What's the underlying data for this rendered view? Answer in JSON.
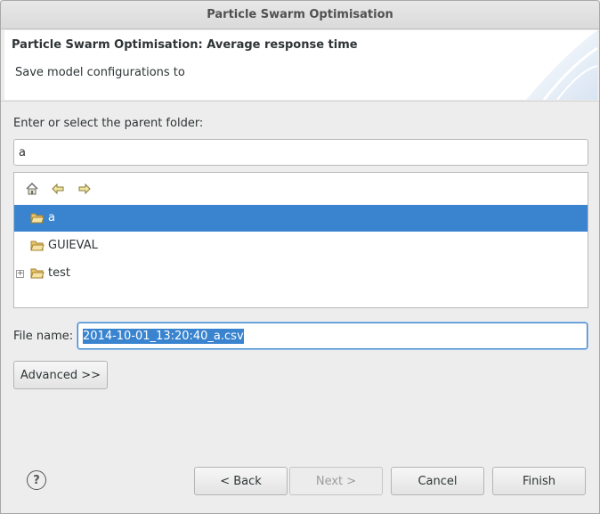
{
  "window": {
    "title": "Particle Swarm Optimisation"
  },
  "banner": {
    "title": "Particle Swarm Optimisation: Average response time",
    "description": "Save model configurations to"
  },
  "folder_section": {
    "label": "Enter or select the parent folder:",
    "value": "a"
  },
  "toolbar": {
    "icons": [
      "home-icon",
      "back-arrow-icon",
      "forward-arrow-icon"
    ]
  },
  "tree": {
    "items": [
      {
        "label": "a",
        "selected": true,
        "expandable": false
      },
      {
        "label": "GUIEVAL",
        "selected": false,
        "expandable": false
      },
      {
        "label": "test",
        "selected": false,
        "expandable": true
      }
    ]
  },
  "file": {
    "label": "File name:",
    "value": "2014-10-01_13:20:40_a.csv"
  },
  "buttons": {
    "advanced": "Advanced >>",
    "back": "< Back",
    "next": "Next >",
    "cancel": "Cancel",
    "finish": "Finish"
  },
  "help": {
    "glyph": "?"
  },
  "colors": {
    "selection": "#3a84cf",
    "background": "#ededed"
  }
}
